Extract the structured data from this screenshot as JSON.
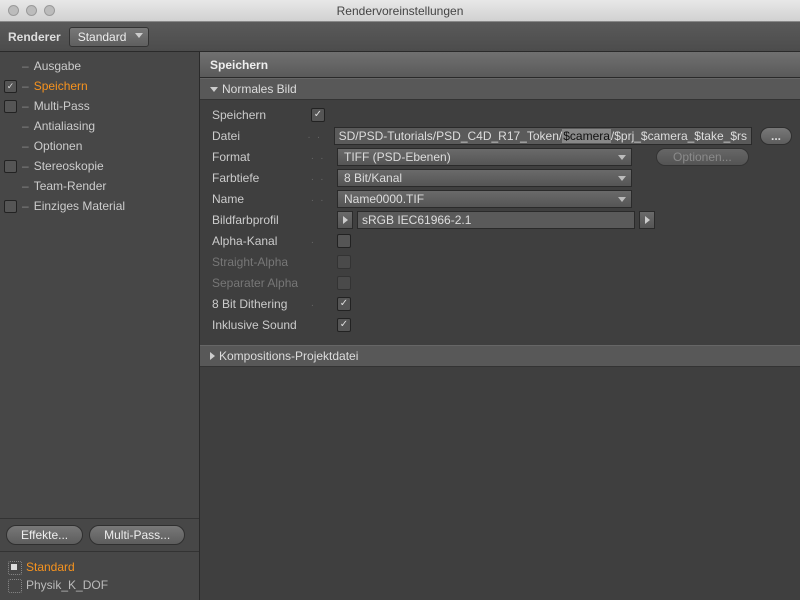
{
  "window": {
    "title": "Rendervoreinstellungen"
  },
  "renderer": {
    "label": "Renderer",
    "value": "Standard"
  },
  "sidebar": {
    "items": [
      {
        "label": "Ausgabe",
        "checkbox": "none"
      },
      {
        "label": "Speichern",
        "checkbox": "checked",
        "active": true
      },
      {
        "label": "Multi-Pass",
        "checkbox": "unchecked"
      },
      {
        "label": "Antialiasing",
        "checkbox": "none"
      },
      {
        "label": "Optionen",
        "checkbox": "none"
      },
      {
        "label": "Stereoskopie",
        "checkbox": "unchecked"
      },
      {
        "label": "Team-Render",
        "checkbox": "none"
      },
      {
        "label": "Einziges Material",
        "checkbox": "unchecked"
      }
    ],
    "effects_btn": "Effekte...",
    "multipass_btn": "Multi-Pass...",
    "presets": [
      {
        "label": "Standard",
        "active": true
      },
      {
        "label": "Physik_K_DOF",
        "active": false
      }
    ]
  },
  "panel": {
    "title": "Speichern"
  },
  "section1": {
    "title": "Normales Bild"
  },
  "form": {
    "save": {
      "label": "Speichern",
      "checked": true
    },
    "file": {
      "label": "Datei",
      "value_pre": "SD/PSD-Tutorials/PSD_C4D_R17_Token/",
      "value_hl": "$camera",
      "value_post": "/$prj_$camera_$take_$rs",
      "browse": "..."
    },
    "format": {
      "label": "Format",
      "value": "TIFF (PSD-Ebenen)",
      "options_btn": "Optionen..."
    },
    "depth": {
      "label": "Farbtiefe",
      "value": "8 Bit/Kanal"
    },
    "name": {
      "label": "Name",
      "value": "Name0000.TIF"
    },
    "profile": {
      "label": "Bildfarbprofil",
      "value": "sRGB IEC61966-2.1"
    },
    "alpha": {
      "label": "Alpha-Kanal",
      "checked": false
    },
    "straight": {
      "label": "Straight-Alpha",
      "checked": false,
      "disabled": true
    },
    "sepalpha": {
      "label": "Separater Alpha",
      "checked": false,
      "disabled": true
    },
    "dither": {
      "label": "8 Bit Dithering",
      "checked": true
    },
    "sound": {
      "label": "Inklusive Sound",
      "checked": true
    }
  },
  "section2": {
    "title": "Kompositions-Projektdatei"
  }
}
